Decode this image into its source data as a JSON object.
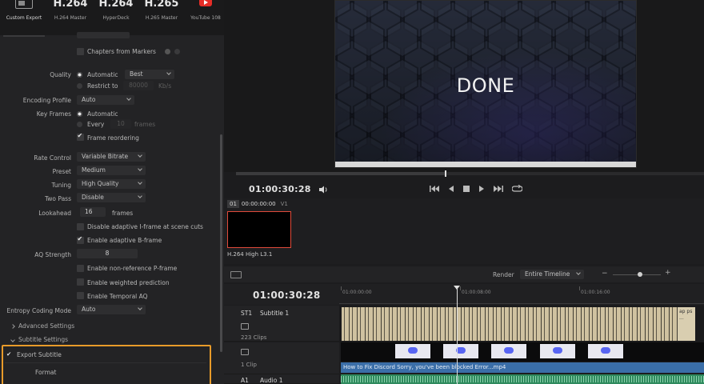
{
  "presets": [
    {
      "big": "",
      "label": "Custom Export",
      "icon": "custom-export-icon"
    },
    {
      "big": "H.264",
      "label": "H.264 Master"
    },
    {
      "big": "H.264",
      "label": "HyperDeck"
    },
    {
      "big": "H.265",
      "label": "H.265 Master"
    },
    {
      "big": "",
      "label": "YouTube 108",
      "icon": "youtube-icon"
    }
  ],
  "settings": {
    "chapters_from_markers": "Chapters from Markers",
    "quality_label": "Quality",
    "quality_automatic": "Automatic",
    "quality_value": "Best",
    "restrict_to": "Restrict to",
    "restrict_value": "80000",
    "restrict_unit": "Kb/s",
    "encoding_profile_label": "Encoding Profile",
    "encoding_profile_value": "Auto",
    "key_frames_label": "Key Frames",
    "key_frames_automatic": "Automatic",
    "key_frames_every": "Every",
    "key_frames_every_value": "10",
    "key_frames_unit": "frames",
    "frame_reordering": "Frame reordering",
    "rate_control_label": "Rate Control",
    "rate_control_value": "Variable Bitrate",
    "preset_label": "Preset",
    "preset_value": "Medium",
    "tuning_label": "Tuning",
    "tuning_value": "High Quality",
    "two_pass_label": "Two Pass",
    "two_pass_value": "Disable",
    "lookahead_label": "Lookahead",
    "lookahead_value": "16",
    "lookahead_unit": "frames",
    "disable_iframe": "Disable adaptive I-frame at scene cuts",
    "enable_bframe": "Enable adaptive B-frame",
    "aq_strength_label": "AQ Strength",
    "aq_strength_value": "8",
    "non_ref_pframe": "Enable non-reference P-frame",
    "weighted_prediction": "Enable weighted prediction",
    "temporal_aq": "Enable Temporal AQ",
    "entropy_label": "Entropy Coding Mode",
    "entropy_value": "Auto",
    "advanced_settings": "Advanced Settings",
    "subtitle_settings": "Subtitle Settings",
    "export_subtitle": "Export Subtitle",
    "format_label": "Format"
  },
  "viewer": {
    "overlay_text": "DONE",
    "timecode": "01:00:30:28"
  },
  "clip": {
    "index": "01",
    "timecode": "00:00:00:00",
    "track": "V1",
    "label": "H.264 High L3.1"
  },
  "render": {
    "label": "Render",
    "value": "Entire Timeline"
  },
  "timeline": {
    "timecode": "01:00:30:28",
    "ruler": [
      "01:00:00:00",
      "01:00:08:00",
      "01:00:16:00"
    ],
    "subtitle_track": {
      "id": "ST1",
      "name": "Subtitle 1",
      "clips": "223 Clips"
    },
    "video_track": {
      "clips": "1 Clip",
      "clip_name": "How to Fix Discord Sorry, you've been blocked Error...mp4"
    },
    "audio_track": {
      "id": "A1",
      "name": "Audio 1"
    },
    "subtitle_end_text": "ap ps ..."
  },
  "colors": {
    "accent_orange": "#e89b2a",
    "clip_red": "#e04a3a",
    "video_blue": "#3a6ea8",
    "audio_green": "#2f8a5e",
    "subtitle_tan": "#cfc2a0"
  }
}
